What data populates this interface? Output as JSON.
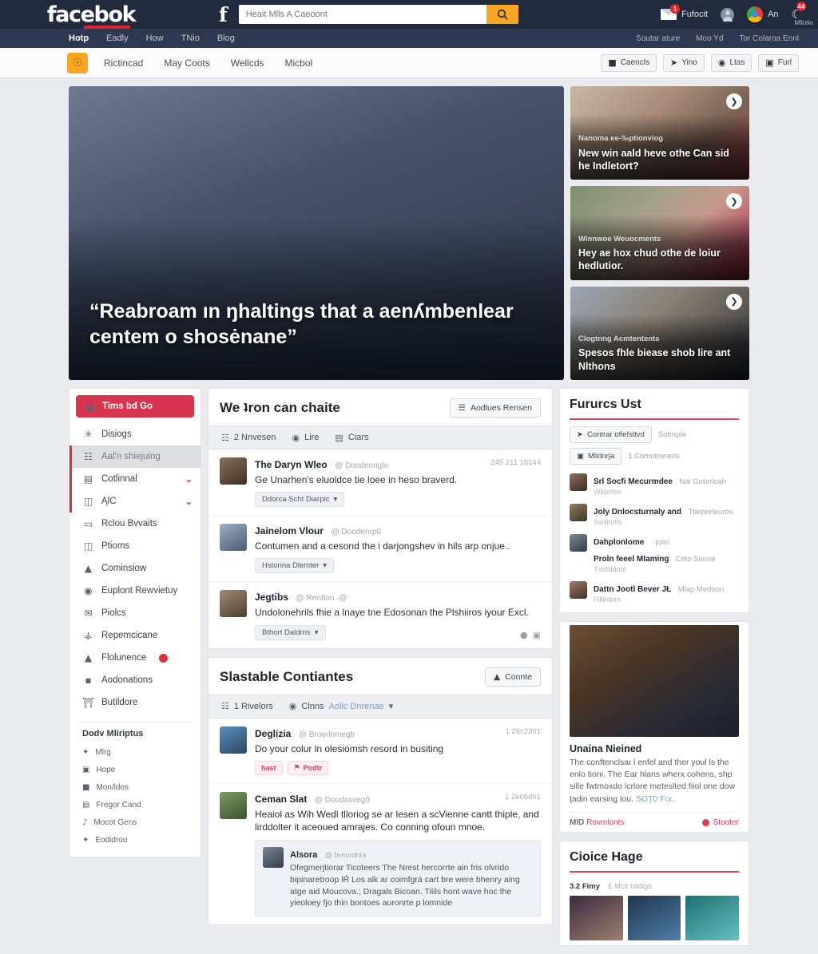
{
  "topbar": {
    "brand": "facebok",
    "f_glyph": "f",
    "search_placeholder": "Heait Mlls A Caeoont",
    "search_icon": "search-icon",
    "notifications": {
      "label": "Fufocit",
      "badge": "1"
    },
    "account_icon": "user-avatar-icon",
    "browser": {
      "label": "An",
      "icon": "chrome-icon"
    },
    "mode": {
      "label": "Mllotio",
      "badge": "44",
      "icon": "moon-icon"
    }
  },
  "nav": {
    "left": [
      {
        "label": "Hotp",
        "active": true
      },
      {
        "label": "Eadly",
        "active": false
      },
      {
        "label": "How",
        "active": false
      },
      {
        "label": "TNio",
        "active": false
      },
      {
        "label": "Blog",
        "active": false
      }
    ],
    "right": [
      "Soutar ature",
      "Moo Yd",
      "Tor Colaroa Ennl"
    ]
  },
  "subbar": {
    "logo_icon": "profile-badge-icon",
    "links": [
      "Rictincad",
      "May Coots",
      "Wellcds",
      "Micbol"
    ],
    "buttons": [
      {
        "label": "Caencls",
        "icon": "bookmark-icon"
      },
      {
        "label": "Yino",
        "icon": "pin-icon"
      },
      {
        "label": "Ltas",
        "icon": "globe-icon"
      },
      {
        "label": "Furl",
        "icon": "image-icon"
      }
    ]
  },
  "hero": {
    "title": "“Reabroam ın ŋhaltings that a aenʎmbenlear centem o shosėnane”"
  },
  "side_cards": [
    {
      "kicker": "Nanoma ĸe‑‰ptionviog",
      "title": "New win aald heve othe Can sid he Indletort?",
      "arrow_icon": "chevron-right-icon"
    },
    {
      "kicker": "Winnwoe Weuocments",
      "title": "Hey ae hox chud othe de loiur hedlutior.",
      "arrow_icon": "chevron-right-icon"
    },
    {
      "kicker": "Clogtnng Acmtentents",
      "title": "Spesos fhle biease shob lire ant Nlthons",
      "arrow_icon": "chevron-right-icon"
    }
  ],
  "sidebar": {
    "active": {
      "label": "Tims bd Go",
      "icon": "grid-icon"
    },
    "items": [
      {
        "label": "Disiogs",
        "icon": "wrench-icon",
        "state": "normal"
      },
      {
        "label": "Aal'n shiejuing",
        "icon": "people-icon",
        "state": "selected"
      },
      {
        "label": "Cotlinnal",
        "icon": "window-icon",
        "state": "bar",
        "chevron": "⌄"
      },
      {
        "label": "ĄlC",
        "icon": "layout-icon",
        "state": "bar",
        "chevron": "⌄"
      },
      {
        "label": "Rclou Bvvaits",
        "icon": "monitor-icon",
        "state": "normal"
      },
      {
        "label": "Ptioms",
        "icon": "briefcase-icon",
        "state": "normal"
      },
      {
        "label": "Cominsiow",
        "icon": "person-icon",
        "state": "normal"
      },
      {
        "label": "Euplont Rewvietuy",
        "icon": "clock-icon",
        "state": "normal"
      },
      {
        "label": "Piolcs",
        "icon": "mail-icon",
        "state": "normal"
      },
      {
        "label": "Repemcicane",
        "icon": "lock-icon",
        "state": "normal"
      },
      {
        "label": "Flolunence",
        "icon": "chart-icon",
        "state": "normal",
        "dot": "●"
      },
      {
        "label": "Aodonations",
        "icon": "book-icon",
        "state": "normal"
      },
      {
        "label": "Butildore",
        "icon": "bank-icon",
        "state": "normal"
      }
    ],
    "footer_heading": "Dodv Mliriptus",
    "footer_items": [
      {
        "label": "Mlrg",
        "icon": "star-icon"
      },
      {
        "label": "Hope",
        "icon": "card-icon"
      },
      {
        "label": "Mon/ldos",
        "icon": "bag-icon"
      },
      {
        "label": "Fregor Cand",
        "icon": "calendar-icon"
      },
      {
        "label": "Mocot Gens",
        "icon": "music-icon"
      },
      {
        "label": "Eodidrou",
        "icon": "pin2-icon"
      }
    ]
  },
  "main": {
    "section1": {
      "title": "We ʇron can chaite",
      "button": {
        "label": "Aodlues Rensen",
        "icon": "filter-icon"
      },
      "filters": [
        {
          "label": "2 Nnvesen",
          "icon": "people-icon"
        },
        {
          "label": "Lire",
          "icon": "globe-icon"
        },
        {
          "label": "Ciars",
          "icon": "list-icon"
        }
      ],
      "posts": [
        {
          "name": "The Daryn Wleo",
          "handle": "@ Doodennglo",
          "time": "245 211 16144",
          "text": "Ge Unarhen's eluoldce tie loee in heso braverd.",
          "tag": "Ddorca Scht Diarpic",
          "avatar": "pa1"
        },
        {
          "name": "Jainelom Vlour",
          "handle": "@ Doodenrp0",
          "time": "",
          "text": "Contumen and a cesond the i darjongshev in hils arp onjue..",
          "tag": "Hstonna Dlemter",
          "avatar": "pa2"
        },
        {
          "name": "Jegtibs",
          "handle": "@ Rerdlon ·@",
          "time": "",
          "text": "Undolonehrils fhie a lnaye tne Edosonan the Plshiiros iyour Excl.",
          "tag": "Bthort Daldrns",
          "avatar": "pa3",
          "foot_icons": [
            "person-icon",
            "image-icon"
          ]
        }
      ]
    },
    "section2": {
      "title": "Slastable Contiantes",
      "button": {
        "label": "Connte",
        "icon": "upload-icon"
      },
      "filters": [
        {
          "label": "1 Rivelors",
          "icon": "people-icon"
        },
        {
          "label": "Clnns",
          "icon": "globe-icon"
        }
      ],
      "filter_link": "Aolic Dnrenae",
      "posts": [
        {
          "name": "Deglizia",
          "handle": "@ Broorlomegb",
          "time": "1 26c2301",
          "text": "Do your colur ln olesiomsh resord in busiting",
          "avatar": "pa4",
          "chips": [
            {
              "label": "hast"
            },
            {
              "label": "Podtr",
              "icon": "flag-icon"
            }
          ]
        },
        {
          "name": "Ceman Slat",
          "handle": "@ Doodasveg0",
          "time": "1 2e06d01",
          "text": "Heaiol as Wih Wedl tlloriog se ar lesen a scVienne cantt thiple, and lirddolter it aceoued amrajes. Co conning ofoun mnoe.",
          "avatar": "pa5",
          "quote": {
            "name": "Alsora",
            "handle": "@ bvsordnra",
            "text": "Ofegmerjtiorar Ticoteers The Nrest hercorrte ain fris olvrido bipinaretroop lŔ Los alk ar coimfgrá cart bre were bhenry aing atge aid Moucova.; Dragals Bicoan. Tilils hont wave hoc the yieoloey fjo thin bontoes auronrte p lomnide"
          }
        }
      ]
    }
  },
  "right": {
    "panel1": {
      "title": "Fururcs Ust",
      "buttons": [
        {
          "label": "Contrar ofiefsltvd",
          "icon": "pin-icon"
        },
        {
          "label": "Mlidnrja",
          "icon": "card-icon"
        }
      ],
      "meta1": "Sotmpla",
      "meta2": "1 Comotnvrens",
      "rows": [
        {
          "name": "Srl Socfi Mecurmdee",
          "muted": "Nai Gobrrlcah",
          "sub": "Wlaxrlon",
          "avatar": "rv1"
        },
        {
          "name": "Joly Dnlocsturnaly and",
          "muted": "Tbeporleuros",
          "sub": "Swillnrlfs",
          "avatar": "rv2"
        },
        {
          "name": "Dahplonlome",
          "muted": "· jolin",
          "sub": "",
          "avatar": "rv3"
        },
        {
          "name": "Proln feeel Mlaming",
          "muted": "Citto Sonne",
          "sub": "Tvldsldore",
          "avatar": ""
        },
        {
          "name": "Dattn Jootl Bever JŁ",
          "muted": "Mlap Medoon",
          "sub": "Fillilskim",
          "avatar": "rv4"
        }
      ]
    },
    "article": {
      "title": "Unaina Nieined",
      "text": "The conftenclsaı l enfel and ther youl ls the enlo tioni. The Ear hlans wherx cohens, shp sille fwtmoxdo lcrlore meteslted fiiol one dow ţadin earsing lou.",
      "link": "SOŢ0 For..",
      "foot_left_num": "MlD",
      "foot_left_label": "Rovmlonts",
      "foot_right": "Stooter"
    },
    "panel2": {
      "title": "Cioice Hage",
      "tag_a": "3.2 Fimy",
      "tag_b": "£ Mcit bildigs"
    }
  }
}
